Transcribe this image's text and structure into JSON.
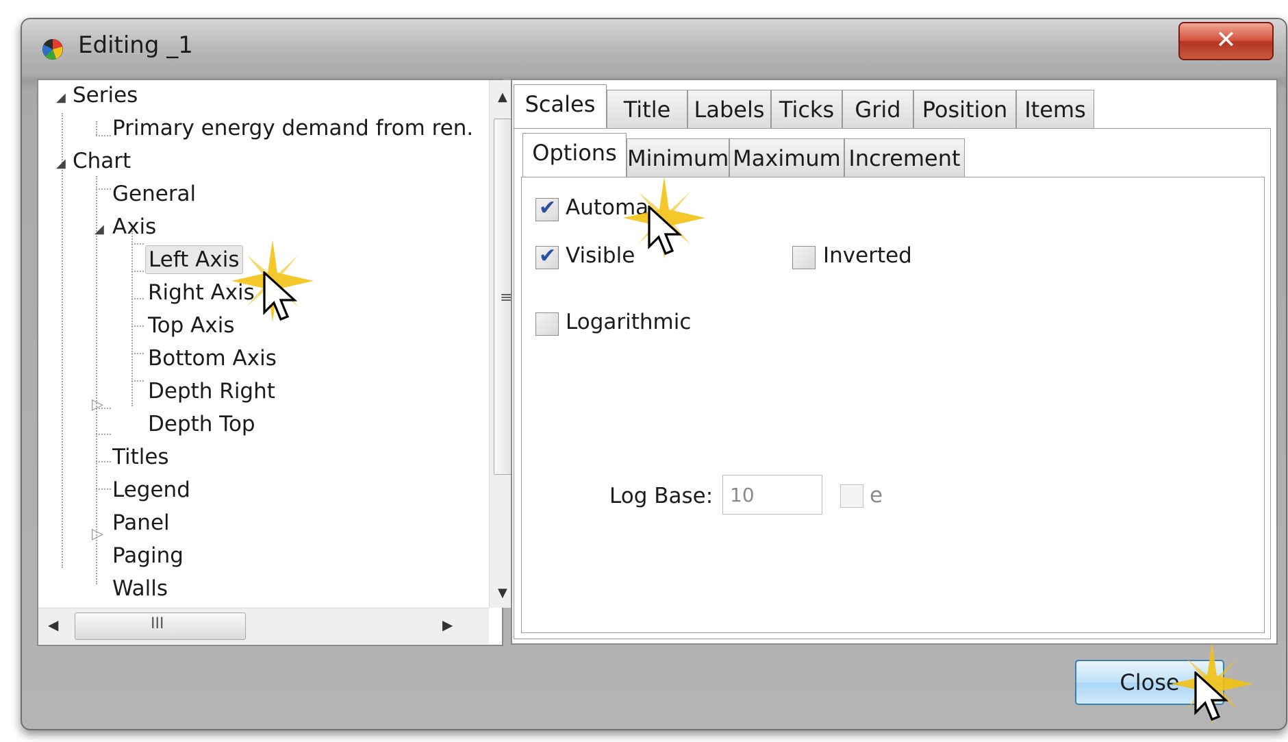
{
  "window": {
    "title": "Editing _1",
    "close_glyph": "✕"
  },
  "tree": {
    "items": [
      {
        "label": "Series",
        "expanded": true
      },
      {
        "label": "Primary energy demand from ren. "
      },
      {
        "label": "Chart",
        "expanded": true
      },
      {
        "label": "General"
      },
      {
        "label": "Axis",
        "expanded": true
      },
      {
        "label": "Left Axis",
        "selected": true
      },
      {
        "label": "Right Axis"
      },
      {
        "label": "Top Axis"
      },
      {
        "label": "Bottom Axis"
      },
      {
        "label": "Depth Right"
      },
      {
        "label": "Depth Top"
      },
      {
        "label": "Titles",
        "expanded": false
      },
      {
        "label": "Legend"
      },
      {
        "label": "Panel"
      },
      {
        "label": "Paging"
      },
      {
        "label": "Walls",
        "expanded": false
      }
    ],
    "scroll_grip": "≡",
    "hscroll_grip": "III"
  },
  "tabs": [
    "Scales",
    "Title",
    "Labels",
    "Ticks",
    "Grid",
    "Position",
    "Items"
  ],
  "active_tab": "Scales",
  "subtabs": [
    "Options",
    "Minimum",
    "Maximum",
    "Increment"
  ],
  "active_subtab": "Options",
  "options": {
    "automatic": {
      "label": "Automa",
      "checked": true
    },
    "visible": {
      "label": "Visible",
      "checked": true
    },
    "inverted": {
      "label": "Inverted",
      "checked": false
    },
    "logarithmic": {
      "label": "Logarithmic",
      "checked": false
    },
    "log_base_label": "Log Base:",
    "log_base_value": "10",
    "e_label": "e"
  },
  "buttons": {
    "close": "Close"
  },
  "colors": {
    "accent": "#3c7fb1",
    "check": "#2a4f9e",
    "titlebar_close": "#c7402c"
  }
}
